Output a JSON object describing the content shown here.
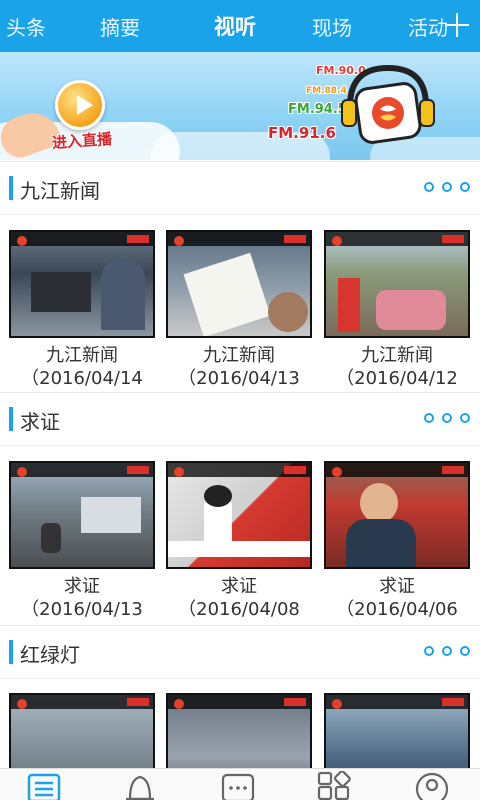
{
  "top_tabs": [
    "头条",
    "摘要",
    "视听",
    "现场",
    "活动"
  ],
  "active_tab": "视听",
  "banner": {
    "enter_live_label": "进入直播",
    "fm_frequencies": [
      "FM.90.0",
      "FM.88.4",
      "FM.94.5",
      "FM.91.6"
    ]
  },
  "sections": [
    {
      "title": "九江新闻",
      "items": [
        "九江新闻（2016/04/14",
        "九江新闻（2016/04/13",
        "九江新闻（2016/04/12"
      ]
    },
    {
      "title": "求证",
      "items": [
        "求证（2016/04/13",
        "求证（2016/04/08",
        "求证（2016/04/06"
      ]
    },
    {
      "title": "红绿灯",
      "items": [
        "",
        "",
        ""
      ]
    }
  ],
  "colors": {
    "accent": "#1aa3e8",
    "fm_red": "#d4262b"
  },
  "bottom_nav_icons": [
    "list-icon",
    "bell-icon",
    "chat-icon",
    "apps-icon",
    "profile-icon"
  ]
}
